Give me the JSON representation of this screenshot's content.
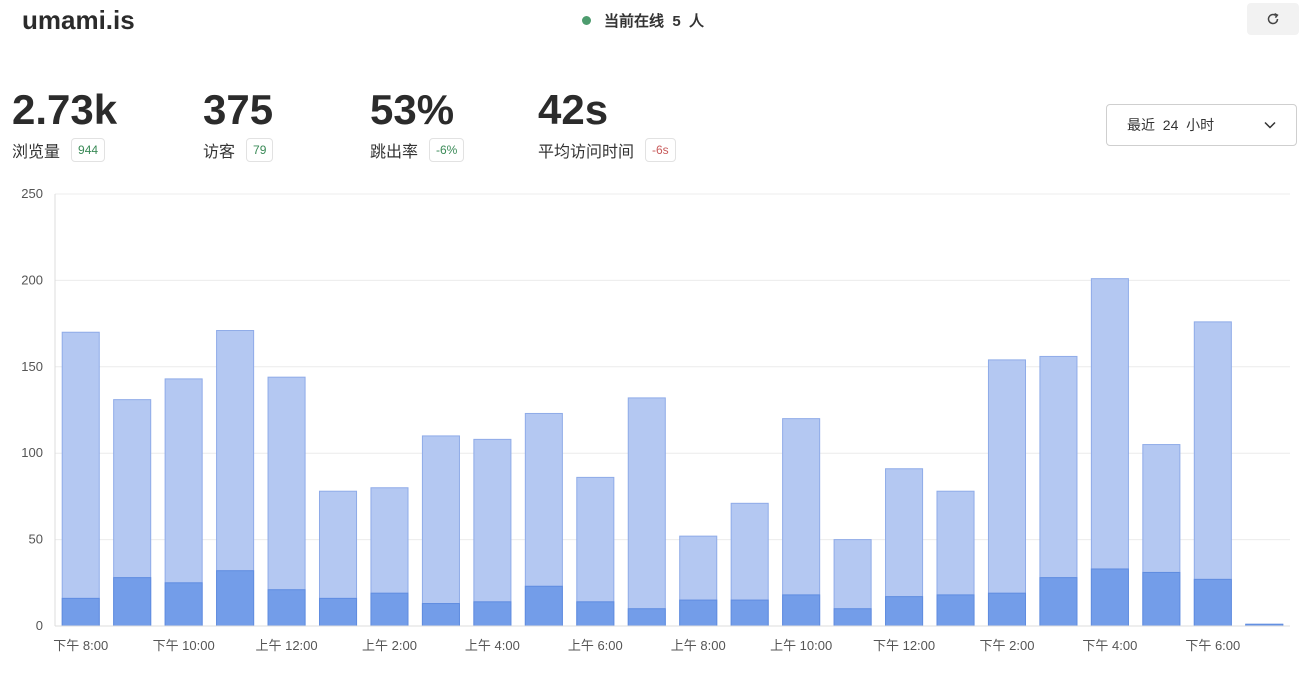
{
  "header": {
    "brand": "umami.is",
    "online_text": "当前在线  5  人",
    "refresh_icon": "refresh-icon"
  },
  "metrics": [
    {
      "value": "2.73k",
      "label": "浏览量",
      "change": "944",
      "trend": "positive"
    },
    {
      "value": "375",
      "label": "访客",
      "change": "79",
      "trend": "positive"
    },
    {
      "value": "53%",
      "label": "跳出率",
      "change": "-6%",
      "trend": "positive"
    },
    {
      "value": "42s",
      "label": "平均访问时间",
      "change": "-6s",
      "trend": "negative"
    }
  ],
  "date_range": {
    "label": "最近  24  小时",
    "icon": "chevron-down-icon"
  },
  "colors": {
    "pageviews_fill": "#b4c8f2",
    "pageviews_stroke": "#8fabe8",
    "visitors_fill": "#739de9",
    "visitors_stroke": "#5f8ce0",
    "online_dot": "#4d9c6e",
    "positive": "#3a8a57",
    "negative": "#c85a5a"
  },
  "chart_data": {
    "type": "bar",
    "ylim": [
      0,
      250
    ],
    "yticks": [
      0,
      50,
      100,
      150,
      200,
      250
    ],
    "xtick_labels": [
      "下午 8:00",
      "下午 10:00",
      "上午 12:00",
      "上午 2:00",
      "上午 4:00",
      "上午 6:00",
      "上午 8:00",
      "上午 10:00",
      "下午 12:00",
      "下午 2:00",
      "下午 4:00",
      "下午 6:00"
    ],
    "series": [
      {
        "values": [
          170,
          131,
          143,
          171,
          144,
          78,
          80,
          110,
          108,
          123,
          86,
          132,
          52,
          71,
          120,
          50,
          91,
          78,
          154,
          156,
          201,
          105,
          176,
          1
        ]
      },
      {
        "values": [
          16,
          28,
          25,
          32,
          21,
          16,
          19,
          13,
          14,
          23,
          14,
          10,
          15,
          15,
          18,
          10,
          17,
          18,
          19,
          28,
          33,
          31,
          27,
          1
        ]
      }
    ]
  }
}
